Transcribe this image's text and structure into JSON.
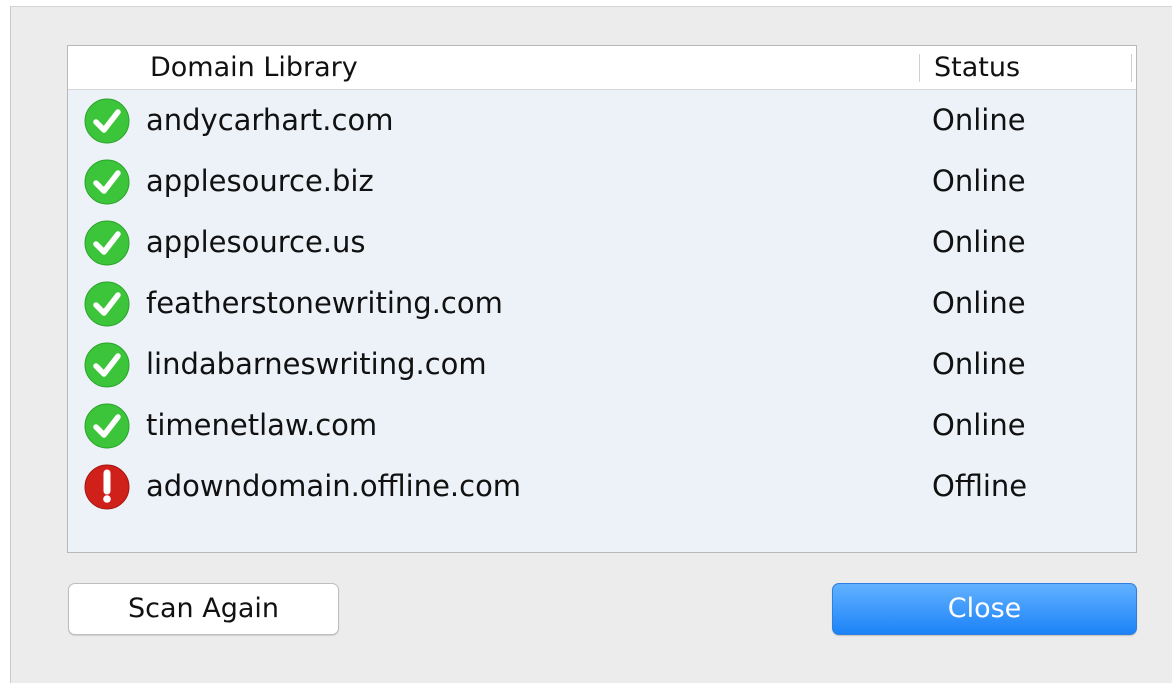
{
  "table": {
    "header": {
      "domain_label": "Domain Library",
      "status_label": "Status"
    },
    "rows": [
      {
        "icon": "check-circle-icon",
        "domain": "andycarhart.com",
        "status": "Online"
      },
      {
        "icon": "check-circle-icon",
        "domain": "applesource.biz",
        "status": "Online"
      },
      {
        "icon": "check-circle-icon",
        "domain": "applesource.us",
        "status": "Online"
      },
      {
        "icon": "check-circle-icon",
        "domain": "featherstonewriting.com",
        "status": "Online"
      },
      {
        "icon": "check-circle-icon",
        "domain": "lindabarneswriting.com",
        "status": "Online"
      },
      {
        "icon": "check-circle-icon",
        "domain": "timenetlaw.com",
        "status": "Online"
      },
      {
        "icon": "alert-circle-icon",
        "domain": "adowndomain.offline.com",
        "status": "Offline"
      }
    ]
  },
  "buttons": {
    "scan_again_label": "Scan Again",
    "close_label": "Close"
  },
  "colors": {
    "online_green": "#3cc43a",
    "offline_red": "#d0201a",
    "accent_blue": "#1c83f8"
  }
}
